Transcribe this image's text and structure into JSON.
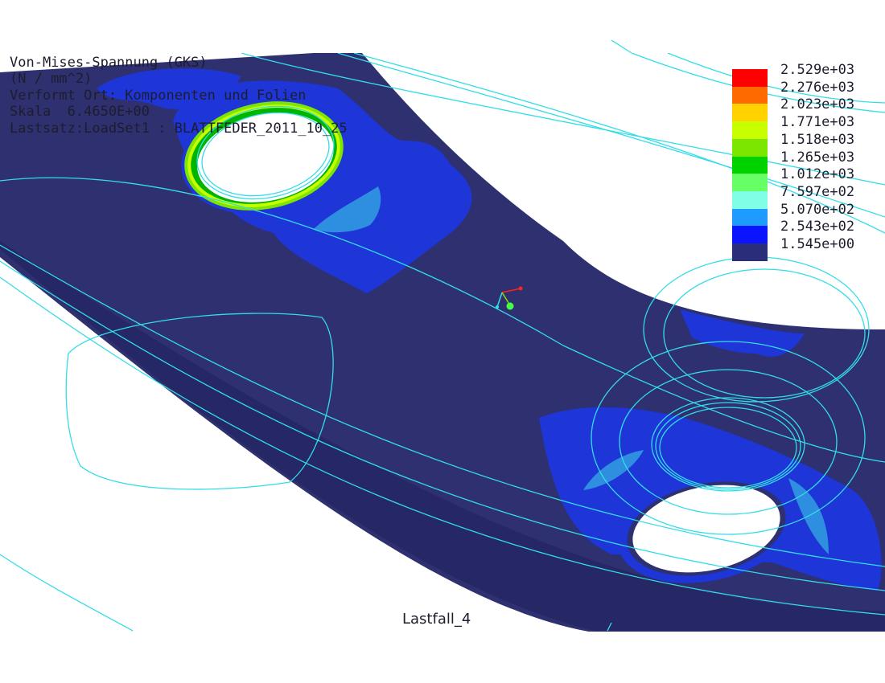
{
  "header": {
    "line1": "Von-Mises-Spannung (GKS)",
    "line2": "(N / mm^2)",
    "line3": "Verformt Ort: Komponenten und Folien",
    "line4": "Skala  6.4650E+00",
    "line5": "Lastsatz:LoadSet1 : BLATTFEDER_2011_10_25"
  },
  "legend": {
    "entries": [
      {
        "value": "2.529e+03",
        "color": "#ff0000"
      },
      {
        "value": "2.276e+03",
        "color": "#ff6a00"
      },
      {
        "value": "2.023e+03",
        "color": "#ffd200"
      },
      {
        "value": "1.771e+03",
        "color": "#c8ff00"
      },
      {
        "value": "1.518e+03",
        "color": "#7ce600"
      },
      {
        "value": "1.265e+03",
        "color": "#00d200"
      },
      {
        "value": "1.012e+03",
        "color": "#66ff66"
      },
      {
        "value": "7.597e+02",
        "color": "#80ffe6"
      },
      {
        "value": "5.070e+02",
        "color": "#1e9bff"
      },
      {
        "value": "2.543e+02",
        "color": "#0a14ff"
      },
      {
        "value": "1.545e+00",
        "color": "#2a2d7a"
      }
    ]
  },
  "footer": {
    "load_case": "Lastfall_4"
  },
  "colors": {
    "part_base": "#2e3070",
    "low_stress": "#1e35d8",
    "mid_stress": "#2e8fe0",
    "wireframe": "#33dde8",
    "background": "#ffffff"
  }
}
